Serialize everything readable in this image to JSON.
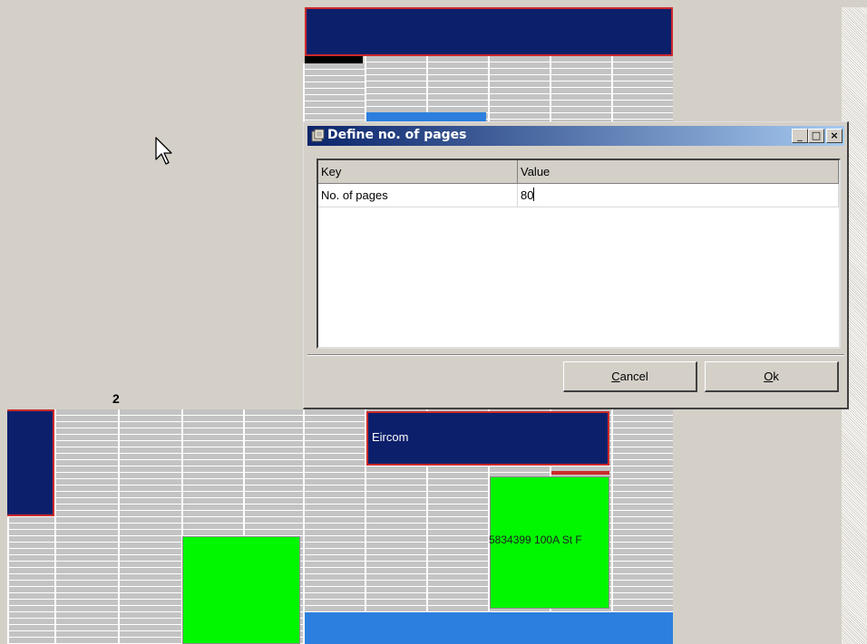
{
  "dialog": {
    "title": "Define no. of pages",
    "minimize_glyph": "_",
    "maximize_glyph": "□",
    "close_glyph": "×",
    "table": {
      "columns": [
        "Key",
        "Value"
      ],
      "rows": [
        {
          "key": "No. of pages",
          "value": "80"
        }
      ]
    },
    "buttons": {
      "cancel_prefix": "C",
      "cancel_rest": "ancel",
      "ok_prefix": "O",
      "ok_rest": "k"
    }
  },
  "canvas": {
    "page_number": "2",
    "ads": {
      "top_navy_text": "",
      "eircom_text": "Eircom",
      "green_middle_text": "5834399 100A St F"
    },
    "colors": {
      "navy": "#0c1f6b",
      "green": "#00f700",
      "blue": "#2c7fde",
      "red_border": "#cc2a2a"
    },
    "icons": [
      "mouse-pointer-icon",
      "application-icon"
    ]
  }
}
